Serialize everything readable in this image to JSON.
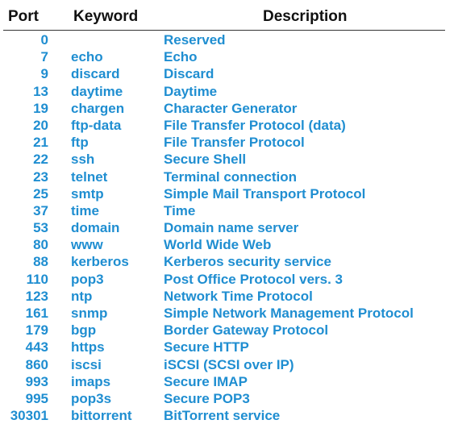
{
  "header": {
    "port": "Port",
    "keyword": "Keyword",
    "description": "Description"
  },
  "rows": [
    {
      "port": "0",
      "keyword": "",
      "description": "Reserved"
    },
    {
      "port": "7",
      "keyword": "echo",
      "description": "Echo"
    },
    {
      "port": "9",
      "keyword": "discard",
      "description": "Discard"
    },
    {
      "port": "13",
      "keyword": "daytime",
      "description": "Daytime"
    },
    {
      "port": "19",
      "keyword": "chargen",
      "description": "Character Generator"
    },
    {
      "port": "20",
      "keyword": "ftp-data",
      "description": "File Transfer Protocol (data)"
    },
    {
      "port": "21",
      "keyword": "ftp",
      "description": "File Transfer Protocol"
    },
    {
      "port": "22",
      "keyword": "ssh",
      "description": "Secure Shell"
    },
    {
      "port": "23",
      "keyword": "telnet",
      "description": "Terminal connection"
    },
    {
      "port": "25",
      "keyword": "smtp",
      "description": "Simple Mail Transport Protocol"
    },
    {
      "port": "37",
      "keyword": "time",
      "description": "Time"
    },
    {
      "port": "53",
      "keyword": "domain",
      "description": "Domain name server"
    },
    {
      "port": "80",
      "keyword": "www",
      "description": "World Wide Web"
    },
    {
      "port": "88",
      "keyword": "kerberos",
      "description": "Kerberos security service"
    },
    {
      "port": "110",
      "keyword": "pop3",
      "description": "Post Office Protocol vers. 3"
    },
    {
      "port": "123",
      "keyword": "ntp",
      "description": "Network Time Protocol"
    },
    {
      "port": "161",
      "keyword": "snmp",
      "description": "Simple Network Management Protocol"
    },
    {
      "port": "179",
      "keyword": "bgp",
      "description": "Border Gateway Protocol"
    },
    {
      "port": "443",
      "keyword": "https",
      "description": "Secure HTTP"
    },
    {
      "port": "860",
      "keyword": "iscsi",
      "description": "iSCSI (SCSI over IP)"
    },
    {
      "port": "993",
      "keyword": "imaps",
      "description": "Secure IMAP"
    },
    {
      "port": "995",
      "keyword": "pop3s",
      "description": "Secure POP3"
    },
    {
      "port": "30301",
      "keyword": "bittorrent",
      "description": "BitTorrent service"
    }
  ],
  "colors": {
    "header_text": "#111111",
    "row_text": "#1f8ed1",
    "rule": "#333333"
  }
}
